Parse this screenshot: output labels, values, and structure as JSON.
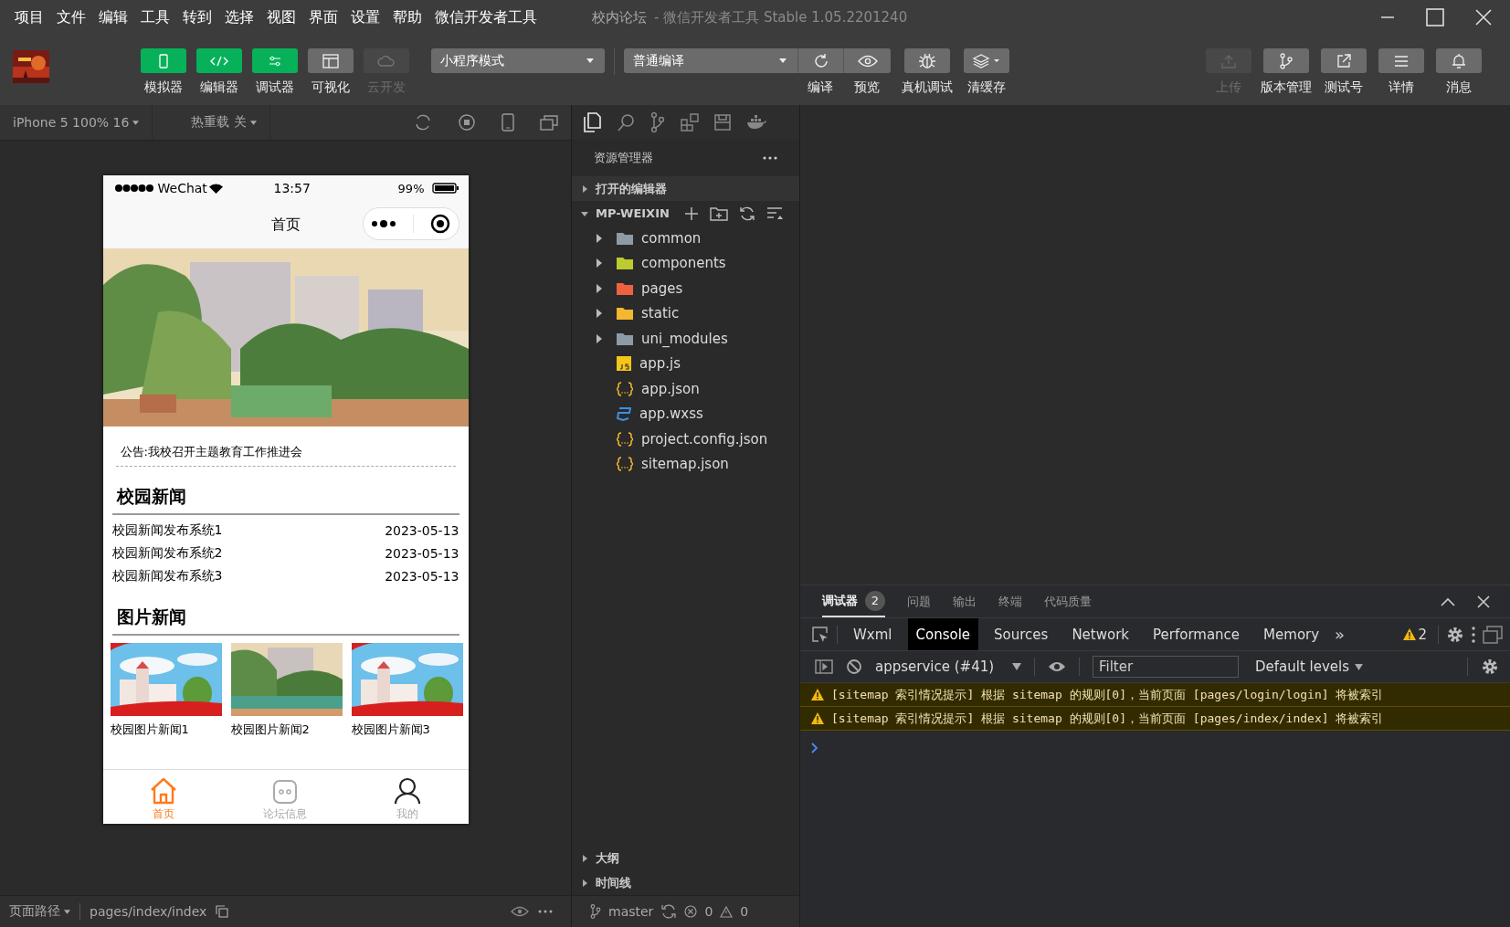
{
  "menu": [
    "项目",
    "文件",
    "编辑",
    "工具",
    "转到",
    "选择",
    "视图",
    "界面",
    "设置",
    "帮助",
    "微信开发者工具"
  ],
  "window": {
    "title": "校内论坛",
    "subtitle": "- 微信开发者工具 Stable 1.05.2201240"
  },
  "toolbar": {
    "view_buttons": [
      {
        "kind": "simulator",
        "label": "模拟器",
        "on": true,
        "disabled": false
      },
      {
        "kind": "editor",
        "label": "编辑器",
        "on": true,
        "disabled": false
      },
      {
        "kind": "debugger",
        "label": "调试器",
        "on": true,
        "disabled": false
      },
      {
        "kind": "visual",
        "label": "可视化",
        "on": false,
        "disabled": false
      },
      {
        "kind": "cloud",
        "label": "云开发",
        "on": false,
        "disabled": true
      }
    ],
    "mode": "小程序模式",
    "compile_mode": "普通编译",
    "actions": [
      {
        "kind": "compile",
        "label": "编译"
      },
      {
        "kind": "preview",
        "label": "预览"
      },
      {
        "kind": "debug",
        "label": "真机调试"
      },
      {
        "kind": "cache",
        "label": "清缓存"
      }
    ],
    "right_buttons": [
      {
        "kind": "upload",
        "label": "上传",
        "disabled": true
      },
      {
        "kind": "version",
        "label": "版本管理",
        "disabled": false
      },
      {
        "kind": "test",
        "label": "测试号",
        "disabled": false
      },
      {
        "kind": "details",
        "label": "详情",
        "disabled": false
      },
      {
        "kind": "messages",
        "label": "消息",
        "disabled": false
      }
    ]
  },
  "simulator": {
    "device": "iPhone 5 100% 16",
    "hot_reload": "热重载 关"
  },
  "phone": {
    "carrier": "WeChat",
    "time": "13:57",
    "battery": "99%",
    "title": "首页",
    "notice": "公告:我校召开主题教育工作推进会",
    "sections": [
      {
        "kind": "list",
        "title": "校园新闻",
        "items": [
          {
            "title": "校园新闻发布系统1",
            "date": "2023-05-13"
          },
          {
            "title": "校园新闻发布系统2",
            "date": "2023-05-13"
          },
          {
            "title": "校园新闻发布系统3",
            "date": "2023-05-13"
          }
        ]
      },
      {
        "kind": "gallery",
        "title": "图片新闻",
        "items": [
          {
            "caption": "校园图片新闻1"
          },
          {
            "caption": "校园图片新闻2"
          },
          {
            "caption": "校园图片新闻3"
          }
        ]
      }
    ],
    "tabs": [
      {
        "kind": "home",
        "label": "首页",
        "selected": true
      },
      {
        "kind": "forum",
        "label": "论坛信息",
        "selected": false
      },
      {
        "kind": "me",
        "label": "我的",
        "selected": false
      }
    ]
  },
  "explorer": {
    "title": "资源管理器",
    "open_editors": {
      "label": "打开的编辑器",
      "expanded": false
    },
    "project": {
      "label": "MP-WEIXIN",
      "expanded": true,
      "children": [
        {
          "kind": "folder",
          "name": "common",
          "color": "#8d9ba7",
          "expanded": false
        },
        {
          "kind": "folder",
          "name": "components",
          "color": "#bccb2f",
          "expanded": false
        },
        {
          "kind": "folder",
          "name": "pages",
          "color": "#f0623f",
          "expanded": false
        },
        {
          "kind": "folder",
          "name": "static",
          "color": "#f5b72f",
          "expanded": false
        },
        {
          "kind": "folder",
          "name": "uni_modules",
          "color": "#8d9ba7",
          "expanded": false
        },
        {
          "kind": "js",
          "name": "app.js"
        },
        {
          "kind": "json",
          "name": "app.json"
        },
        {
          "kind": "css",
          "name": "app.wxss"
        },
        {
          "kind": "json",
          "name": "project.config.json"
        },
        {
          "kind": "json",
          "name": "sitemap.json"
        }
      ]
    },
    "bottom_sections": [
      {
        "label": "大纲",
        "expanded": false
      },
      {
        "label": "时间线",
        "expanded": false
      }
    ]
  },
  "devtools": {
    "tabs": [
      {
        "label": "调试器",
        "badge": "2",
        "selected": true
      },
      {
        "label": "问题",
        "selected": false
      },
      {
        "label": "输出",
        "selected": false
      },
      {
        "label": "终端",
        "selected": false
      },
      {
        "label": "代码质量",
        "selected": false
      }
    ],
    "panels": [
      {
        "label": "Wxml",
        "selected": false
      },
      {
        "label": "Console",
        "selected": true
      },
      {
        "label": "Sources",
        "selected": false
      },
      {
        "label": "Network",
        "selected": false
      },
      {
        "label": "Performance",
        "selected": false
      },
      {
        "label": "Memory",
        "selected": false
      }
    ],
    "more": "»",
    "warning_count": "2",
    "context": "appservice (#41)",
    "filter_placeholder": "Filter",
    "levels": "Default levels",
    "messages": [
      {
        "kind": "warning",
        "text": "[sitemap 索引情况提示] 根据 sitemap 的规则[0]，当前页面 [pages/login/login] 将被索引"
      },
      {
        "kind": "warning",
        "text": "[sitemap 索引情况提示] 根据 sitemap 的规则[0]，当前页面 [pages/index/index] 将被索引"
      }
    ]
  },
  "status": {
    "path_label": "页面路径",
    "path": "pages/index/index",
    "branch": "master",
    "errors": "0",
    "warnings": "0"
  }
}
